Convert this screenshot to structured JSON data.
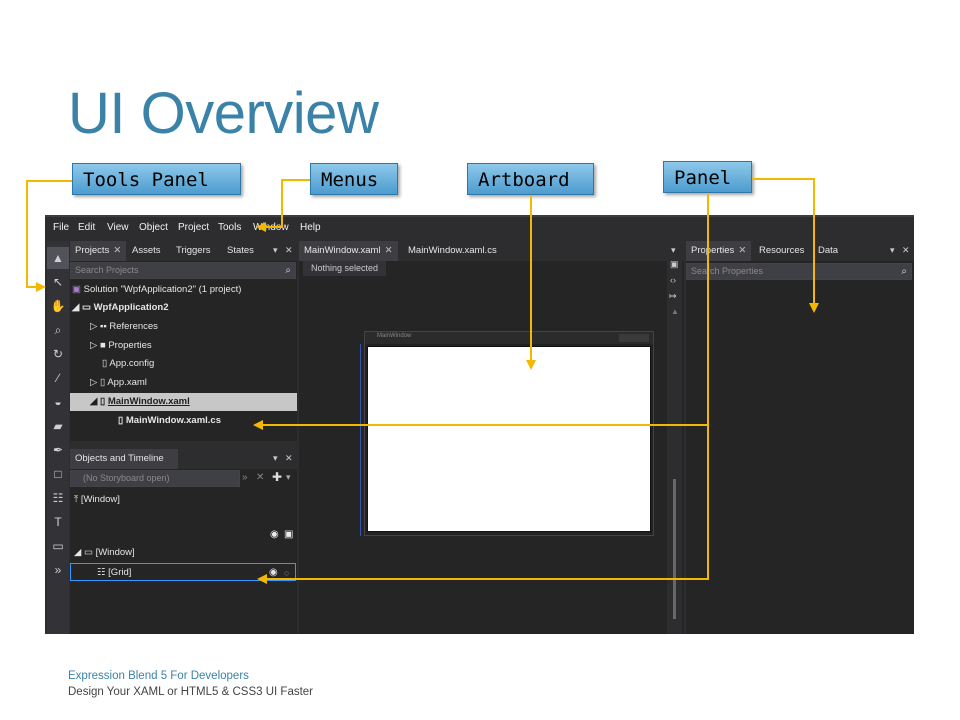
{
  "slide": {
    "title": "UI Overview",
    "footer_line1": "Expression Blend 5 For Developers",
    "footer_line2": "Design Your XAML or HTML5 & CSS3 UI Faster",
    "accent_color": "#3b82a8",
    "arrow_color": "#f5b800"
  },
  "callouts": {
    "tools_panel": "Tools Panel",
    "menus": "Menus",
    "artboard": "Artboard",
    "panel": "Panel"
  },
  "menu": {
    "items": [
      "File",
      "Edit",
      "View",
      "Object",
      "Project",
      "Tools",
      "Window",
      "Help"
    ]
  },
  "tools": {
    "icons": [
      "selection-icon",
      "direct-selection-icon",
      "pan-icon",
      "zoom-icon",
      "camera-orbit-icon",
      "eyedropper-icon",
      "paint-bucket-icon",
      "eraser-icon",
      "pen-icon",
      "rectangle-icon",
      "grid-icon",
      "text-icon",
      "callout-icon",
      "more-tools-icon"
    ]
  },
  "projects_panel": {
    "tabs": [
      "Projects",
      "Assets",
      "Triggers",
      "States"
    ],
    "search_placeholder": "Search Projects",
    "tree": [
      "Solution \"WpfApplication2\" (1 project)",
      "WpfApplication2",
      "References",
      "Properties",
      "App.config",
      "App.xaml",
      "MainWindow.xaml",
      "MainWindow.xaml.cs"
    ]
  },
  "objects_panel": {
    "title": "Objects and Timeline",
    "storyboard": "(No Storyboard open)",
    "rows": [
      "[Window]",
      "[Window]",
      "[Grid]"
    ]
  },
  "document": {
    "tabs": [
      "MainWindow.xaml",
      "MainWindow.xaml.cs"
    ],
    "selection_status": "Nothing selected",
    "window_title": "MainWindow"
  },
  "properties_panel": {
    "tabs": [
      "Properties",
      "Resources",
      "Data"
    ],
    "search_placeholder": "Search Properties"
  }
}
